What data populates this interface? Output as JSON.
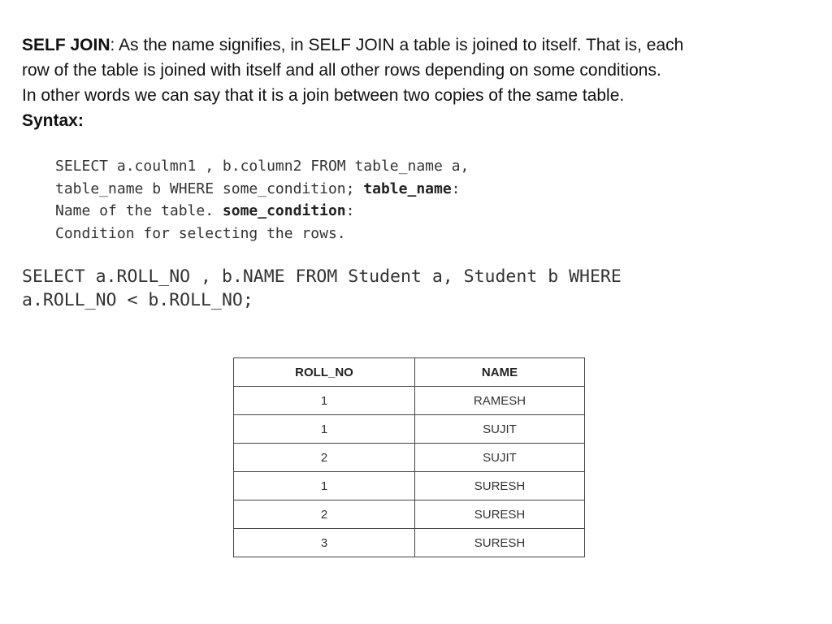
{
  "intro": {
    "term": "SELF JOIN",
    "definition_lines": [
      ": As the name signifies, in SELF JOIN a table is joined to itself. That is, each",
      "row of the table is joined with itself and all other rows depending on some conditions.",
      "In other words we can say that it is a join between two copies of the same table."
    ],
    "syntax_label": "Syntax:"
  },
  "syntax": {
    "line1": "SELECT a.coulmn1 , b.column2 FROM table_name a,",
    "line2_prefix": "table_name b WHERE some_condition; ",
    "line2_bold": "table_name",
    "line2_suffix": ":",
    "line3_prefix": "Name of the table. ",
    "line3_bold": "some_condition",
    "line3_suffix": ":",
    "line4": "Condition for selecting the rows."
  },
  "example": {
    "line1": "SELECT a.ROLL_NO , b.NAME FROM Student a, Student b WHERE",
    "line2": "a.ROLL_NO < b.ROLL_NO;"
  },
  "result_table": {
    "headers": [
      "ROLL_NO",
      "NAME"
    ],
    "rows": [
      [
        "1",
        "RAMESH"
      ],
      [
        "1",
        "SUJIT"
      ],
      [
        "2",
        "SUJIT"
      ],
      [
        "1",
        "SURESH"
      ],
      [
        "2",
        "SURESH"
      ],
      [
        "3",
        "SURESH"
      ]
    ]
  }
}
